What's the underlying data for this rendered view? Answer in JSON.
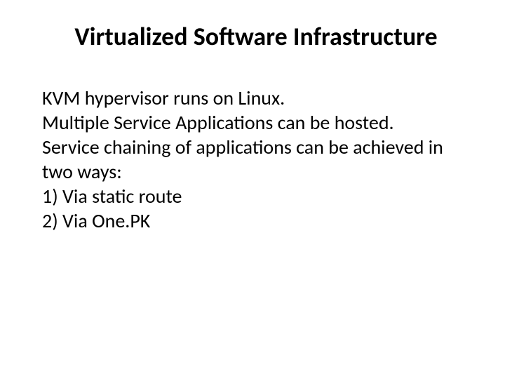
{
  "title": "Virtualized Software Infrastructure",
  "lines": {
    "l1": "KVM hypervisor runs on Linux.",
    "l2": "Multiple Service Applications can be hosted.",
    "l3": "Service chaining of applications can be achieved in two ways:",
    "l4": "1)  Via static route",
    "l5": "2)  Via One.PK"
  }
}
